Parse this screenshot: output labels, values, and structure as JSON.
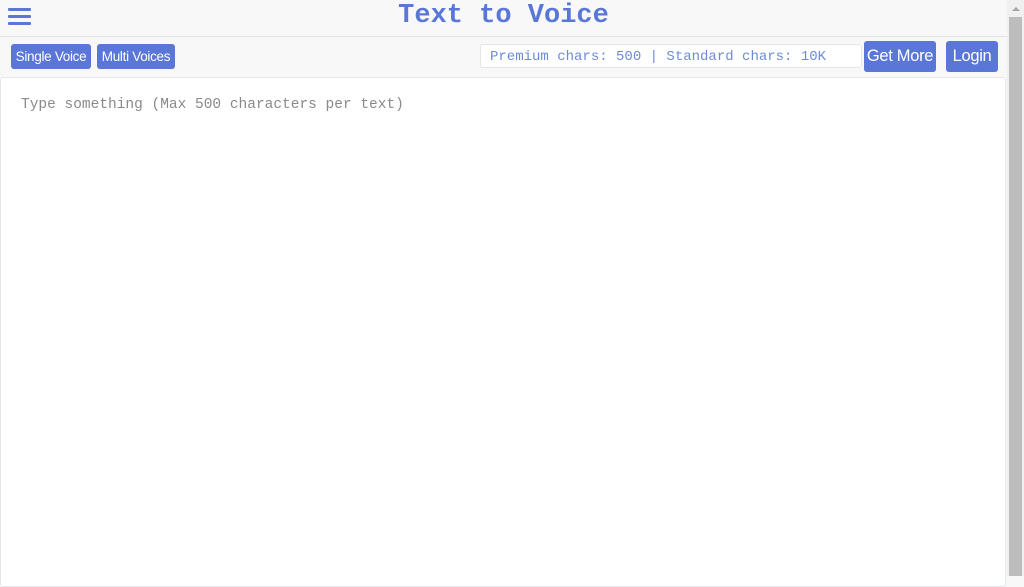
{
  "header": {
    "title": "Text to Voice",
    "menu_icon": "hamburger-menu-icon"
  },
  "toolbar": {
    "single_voice_label": "Single Voice",
    "multi_voices_label": "Multi Voices",
    "chars_info": "Premium chars: 500 | Standard chars: 10K",
    "get_more_label": "Get More",
    "login_label": "Login"
  },
  "editor": {
    "value": "",
    "placeholder": "Type something (Max 500 characters per text)"
  },
  "colors": {
    "accent": "#5a76d6",
    "chars_text": "#6b8bd8",
    "placeholder": "#8a8a8a"
  }
}
